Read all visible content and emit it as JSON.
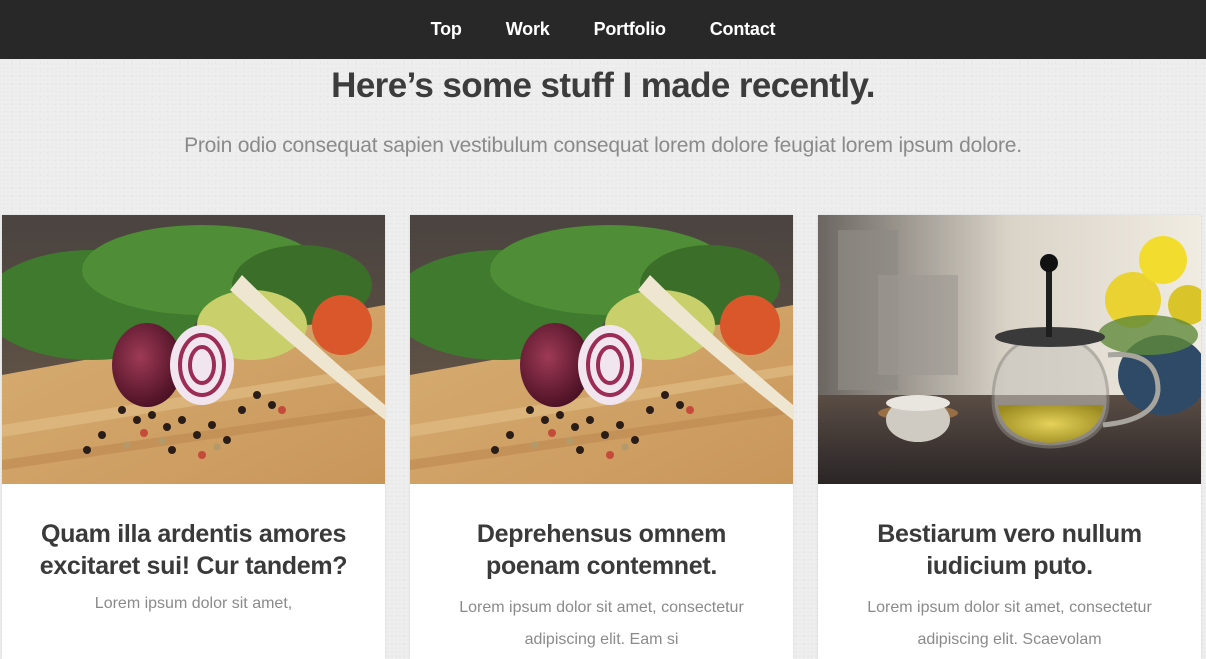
{
  "nav": {
    "items": [
      {
        "label": "Top"
      },
      {
        "label": "Work"
      },
      {
        "label": "Portfolio"
      },
      {
        "label": "Contact"
      }
    ]
  },
  "header": {
    "title": "Here’s some stuff I made recently.",
    "subtitle": "Proin odio consequat sapien vestibulum consequat lorem dolore feugiat lorem ipsum dolore."
  },
  "cards": [
    {
      "image": "vegetables-cutting-board-photo",
      "title": "Quam illa ardentis amores excitaret sui! Cur tandem?",
      "text": "Lorem ipsum dolor sit amet,"
    },
    {
      "image": "vegetables-cutting-board-photo",
      "title": "Deprehensus omnem poenam contemnet.",
      "text": "Lorem ipsum dolor sit amet, consectetur adipiscing elit. Eam si"
    },
    {
      "image": "teapot-kitchen-photo",
      "title": "Bestiarum vero nullum iudicium puto.",
      "text": "Lorem ipsum dolor sit amet, consectetur adipiscing elit. Scaevolam"
    }
  ],
  "colors": {
    "nav_bg": "#282828",
    "nav_text": "#ffffff",
    "page_bg": "#ececec",
    "heading": "#3c3c3c",
    "muted_text": "#8a8a8a"
  }
}
